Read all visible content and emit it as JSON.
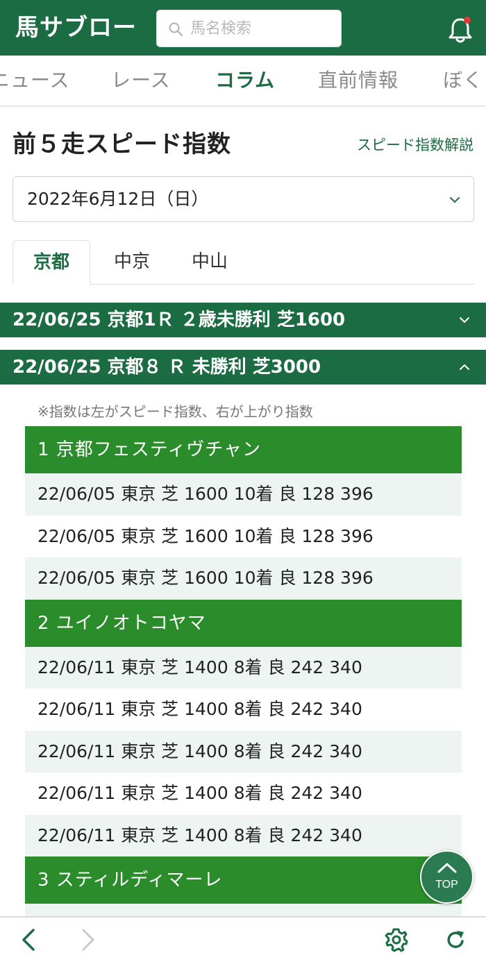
{
  "header": {
    "logo": "馬サブロー",
    "search_placeholder": "馬名検索"
  },
  "nav_tabs": [
    {
      "label": "ニュース",
      "active": false
    },
    {
      "label": "レース",
      "active": false
    },
    {
      "label": "コラム",
      "active": true
    },
    {
      "label": "直前情報",
      "active": false
    },
    {
      "label": "ぼく",
      "active": false
    }
  ],
  "page": {
    "title": "前５走スピード指数",
    "help_link": "スピード指数解説",
    "date_selected": "2022年6月12日（日）"
  },
  "venue_tabs": [
    {
      "label": "京都",
      "active": true
    },
    {
      "label": "中京",
      "active": false
    },
    {
      "label": "中山",
      "active": false
    }
  ],
  "races": [
    {
      "title": "22/06/25 京都1Ｒ ２歳未勝利 芝1600",
      "expanded": false
    },
    {
      "title": "22/06/25 京都８ Ｒ 未勝利 芝3000",
      "expanded": true
    }
  ],
  "note": "※指数は左がスピード指数、右が上がり指数",
  "horses": [
    {
      "name": "1 京都フェスティヴチャン",
      "runs": [
        "22/06/05 東京 芝 1600 10着 良 128 396",
        "22/06/05 東京 芝 1600 10着 良 128 396",
        "22/06/05 東京 芝 1600 10着 良 128 396"
      ]
    },
    {
      "name": "2 ユイノオトコヤマ",
      "runs": [
        "22/06/11 東京 芝 1400 8着 良 242 340",
        "22/06/11 東京 芝 1400 8着 良 242 340",
        "22/06/11 東京 芝 1400 8着 良 242 340",
        "22/06/11 東京 芝 1400 8着 良 242 340",
        "22/06/11 東京 芝 1400 8着 良 242 340"
      ]
    },
    {
      "name": "3 スティルディマーレ",
      "runs": []
    }
  ],
  "top_button": "TOP",
  "colors": {
    "brand_green": "#1b6b43",
    "horse_header_green": "#2a8c2a",
    "row_alt": "#eef4f2",
    "notification_dot": "#e53935"
  }
}
